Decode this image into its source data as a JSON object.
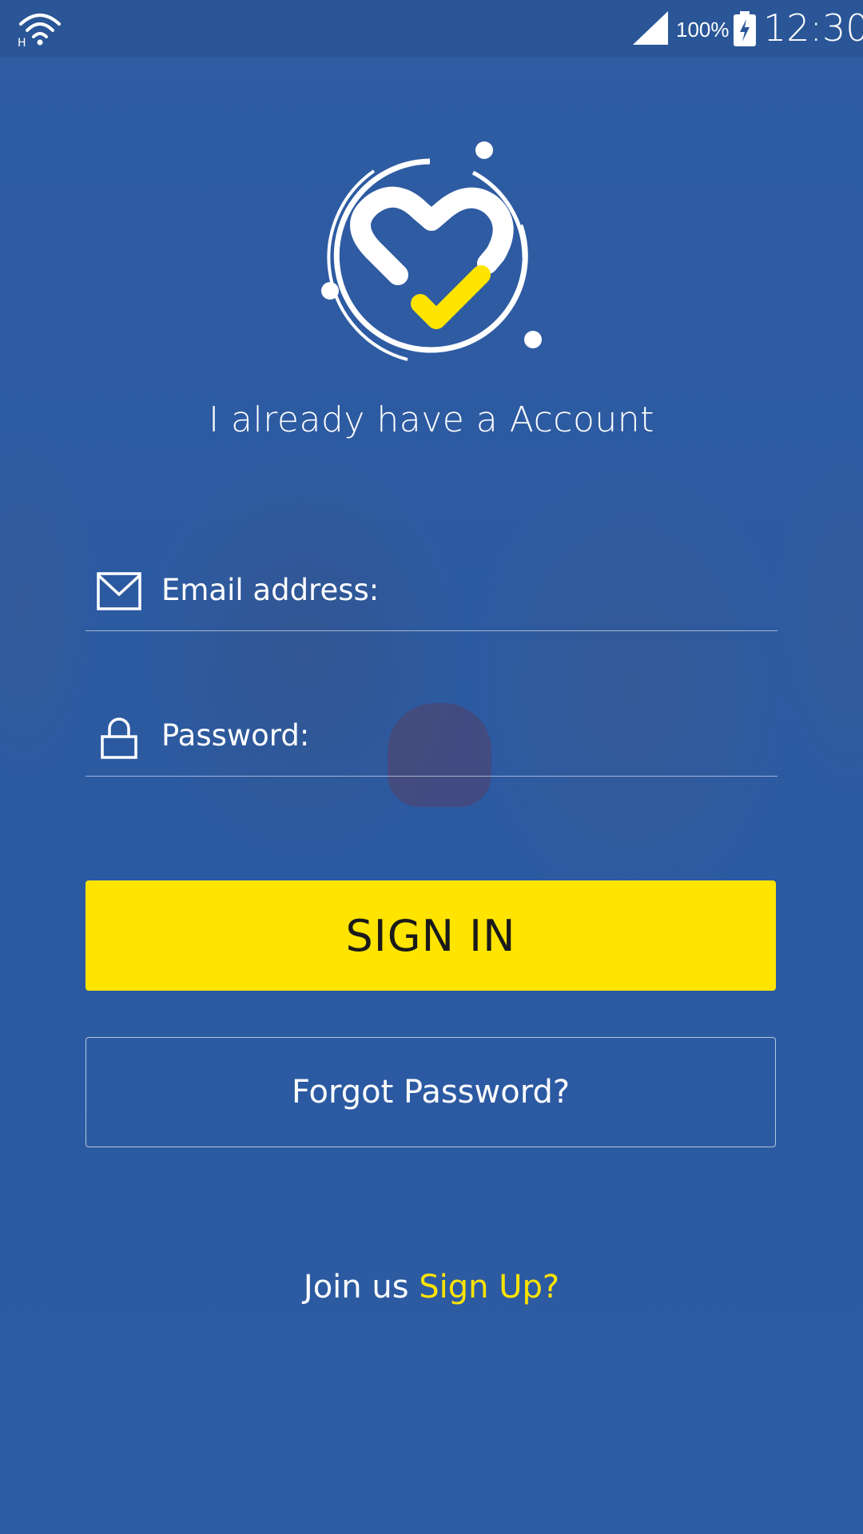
{
  "status_bar": {
    "battery_percent": "100%",
    "time": "12:30",
    "network_type": "H"
  },
  "login": {
    "heading": "I already have a Account",
    "email_placeholder": "Email address:",
    "password_placeholder": "Password:",
    "signin_label": "SIGN IN",
    "forgot_label": "Forgot Password?",
    "join_text": "Join us",
    "signup_label": "Sign Up?"
  },
  "colors": {
    "background": "#2d5aa0",
    "accent": "#ffe400",
    "text": "#ffffff"
  },
  "icons": {
    "wifi": "wifi-icon",
    "signal": "signal-icon",
    "battery": "battery-charging-icon",
    "logo": "heart-check-logo",
    "email": "envelope-icon",
    "password": "lock-icon"
  }
}
